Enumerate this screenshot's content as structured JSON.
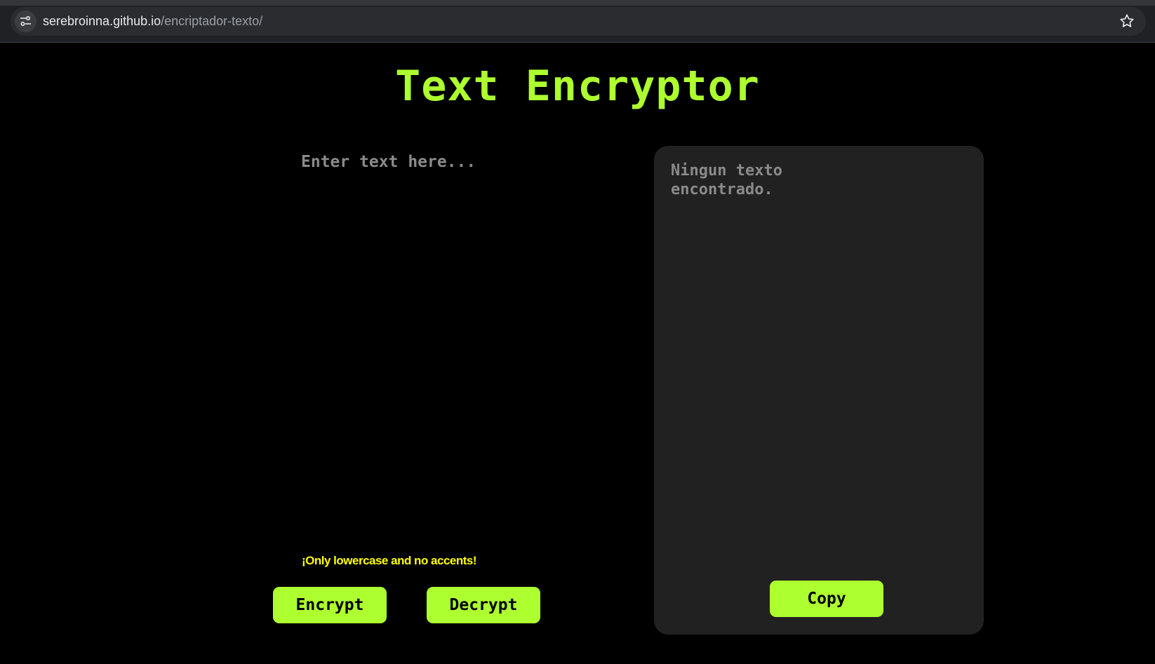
{
  "browser": {
    "url_host": "serebroinna.github.io",
    "url_path": "/encriptador-texto/"
  },
  "page": {
    "title": "Text Encryptor",
    "input_placeholder": "Enter text here...",
    "input_value": "",
    "warning": "¡Only lowercase and no accents!",
    "encrypt_label": "Encrypt",
    "decrypt_label": "Decrypt",
    "output_text": "Ningun texto encontrado.",
    "copy_label": "Copy"
  },
  "colors": {
    "accent": "#adff2f",
    "warning": "#ffff00",
    "panel": "#212121",
    "background": "#000000"
  },
  "icons": {
    "site_info": "tune-icon",
    "bookmark": "star-icon"
  }
}
